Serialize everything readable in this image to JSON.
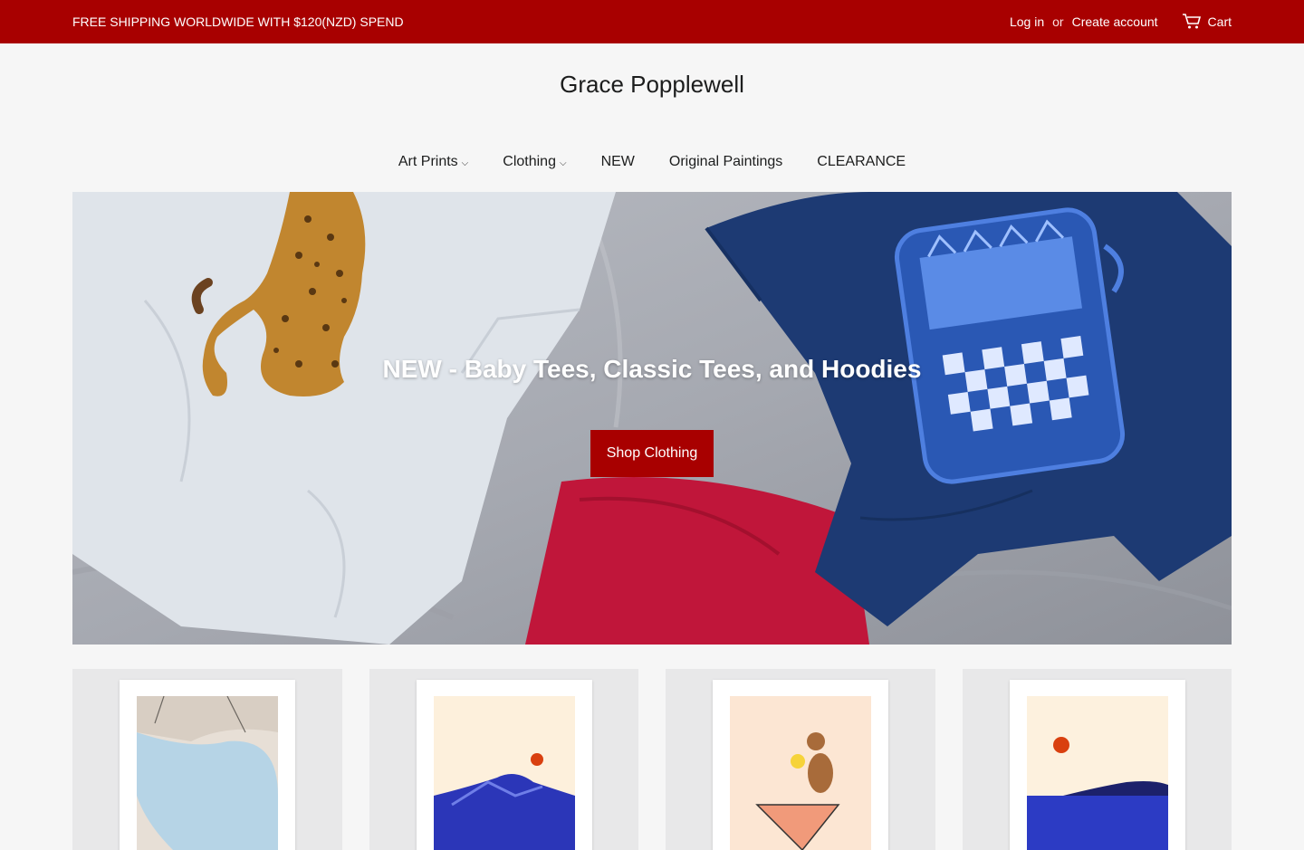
{
  "announcement": {
    "text": "FREE SHIPPING WORLDWIDE WITH $120(NZD) SPEND",
    "login": "Log in",
    "or": "or",
    "create_account": "Create account",
    "cart": "Cart"
  },
  "store": {
    "name": "Grace Popplewell"
  },
  "nav": {
    "items": [
      {
        "label": "Art Prints",
        "has_dropdown": true
      },
      {
        "label": "Clothing",
        "has_dropdown": true
      },
      {
        "label": "NEW",
        "has_dropdown": false
      },
      {
        "label": "Original Paintings",
        "has_dropdown": false
      },
      {
        "label": "CLEARANCE",
        "has_dropdown": false
      }
    ],
    "chevron": "⌵"
  },
  "hero": {
    "title": "NEW - Baby Tees, Classic Tees, and Hoodies",
    "button": "Shop Clothing"
  },
  "colors": {
    "accent": "#a80000",
    "background": "#f6f6f6"
  },
  "products": [
    {
      "art": "pool-scene-print"
    },
    {
      "art": "blue-mountain-sun-print"
    },
    {
      "art": "monkey-cocktail-print"
    },
    {
      "art": "sea-island-sun-print"
    }
  ]
}
